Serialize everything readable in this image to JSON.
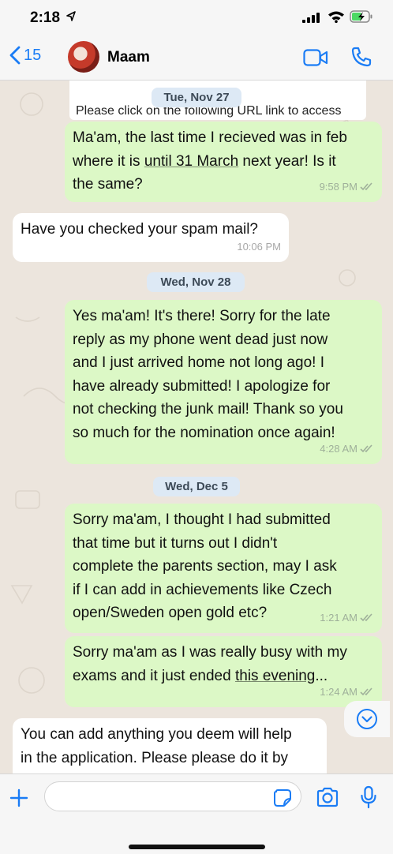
{
  "status": {
    "time": "2:18"
  },
  "header": {
    "back_count": "15",
    "contact_name": "Maam"
  },
  "chat": {
    "quoted_preview": "Please click on the following URL link to access",
    "date_chips": [
      "Tue, Nov 27",
      "Wed, Nov 28",
      "Wed, Dec 5"
    ],
    "messages": [
      {
        "direction": "outgoing",
        "lines": [
          "Ma'am, the last time I recieved was in feb",
          "where it is until 31 March next year! Is it",
          "the same?"
        ],
        "link_text": "until 31 March",
        "time": "9:58 PM"
      },
      {
        "direction": "incoming",
        "lines": [
          "Have you checked your spam mail?"
        ],
        "time": "10:06 PM"
      },
      {
        "direction": "outgoing",
        "lines": [
          "Yes ma'am! It's there! Sorry for the late",
          "reply as my phone went dead just now",
          "and I just arrived home not long ago! I",
          "have already submitted!  I apologize for",
          "not checking the junk mail! Thank so you",
          "so much for the nomination once again!"
        ],
        "time": "4:28 AM"
      },
      {
        "direction": "outgoing",
        "lines": [
          "Sorry ma'am, I thought I had submitted",
          "that time but it turns out I didn't",
          "complete the parents section, may I ask",
          "if I can add in achievements like Czech",
          "open/Sweden open gold etc?"
        ],
        "time": "1:21 AM"
      },
      {
        "direction": "outgoing",
        "lines": [
          "Sorry ma'am as I was really busy with my",
          "exams and it just ended this evening..."
        ],
        "link_text": "this evening",
        "time": "1:24 AM"
      },
      {
        "direction": "incoming",
        "lines": [
          "You can add anything you deem will help",
          "in the application. Please please do it by"
        ]
      }
    ]
  },
  "colors": {
    "outgoing_bubble": "#dcf8c6",
    "incoming_bubble": "#ffffff",
    "accent": "#1a7cf5",
    "chat_background": "#ece5dd"
  },
  "icons": [
    "location-arrow-icon",
    "signal-icon",
    "wifi-icon",
    "battery-icon",
    "chevron-left-icon",
    "video-call-icon",
    "phone-icon",
    "double-check-icon",
    "chevron-down-icon",
    "plus-icon",
    "sticker-icon",
    "camera-icon",
    "microphone-icon"
  ]
}
